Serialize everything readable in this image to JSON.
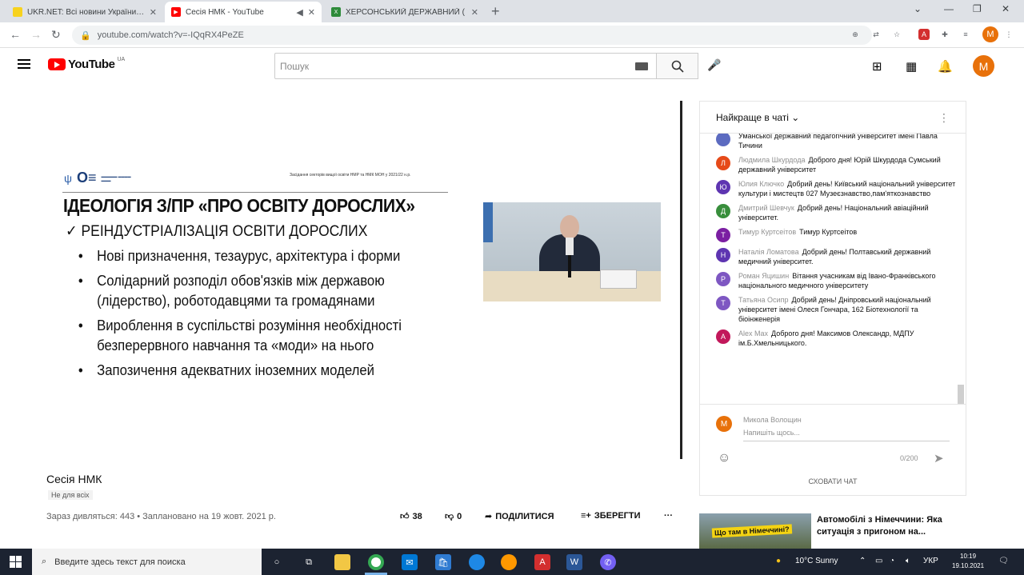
{
  "browser": {
    "tabs": [
      {
        "title": "UKR.NET: Всі новини України, о"
      },
      {
        "title": "Сесія НМК - YouTube"
      },
      {
        "title": "ХЕРСОНСЬКИЙ ДЕРЖАВНИЙ ("
      }
    ],
    "url": "youtube.com/watch?v=-IQqRX4PeZE"
  },
  "youtube": {
    "logo_text": "YouTube",
    "country": "UA",
    "search_placeholder": "Пошук",
    "user_initial": "М"
  },
  "slide": {
    "header_right": "Засідання секторів вищої освіти НМР та НМК МОН у 2021/22 н.р.",
    "title": "ІДЕОЛОГІЯ З/ПР «ПРО ОСВІТУ ДОРОСЛИХ»",
    "subtitle": "✓ РЕІНДУСТРІАЛІЗАЦІЯ ОСВІТИ ДОРОСЛИХ",
    "bullets": [
      "Нові призначення, тезаурус, архітектура і форми",
      "Солідарний розподіл обов'язків між державою (лідерство), роботодавцями та громадянами",
      "Вироблення в суспільстві розуміння необхідності безперервного навчання та «моди» на нього",
      "Запозичення адекватних іноземних моделей"
    ]
  },
  "video": {
    "title": "Сесія НМК",
    "audience": "Не для всіх",
    "meta": "Зараз дивляться: 443 • Заплановано на 19 жовт. 2021 р.",
    "likes": "38",
    "dislikes": "0",
    "share_label": "ПОДІЛИТИСЯ",
    "save_label": "ЗБЕРЕГТИ"
  },
  "chat": {
    "header": "Найкраще в чаті",
    "messages": [
      {
        "initial": "",
        "color": "#5c6bc0",
        "author": "",
        "text": "Уманської державний педагогічний університет імені Павла Тичини"
      },
      {
        "initial": "Л",
        "color": "#e64a19",
        "author": "Людмила Шкурдода",
        "text": "Доброго дня! Юрій Шкурдода Сумський державний університет"
      },
      {
        "initial": "Ю",
        "color": "#5e35b1",
        "author": "Юлия Ключко",
        "text": "Добрий день! Київський національний університет культури і мистецтв 027 Музеєзнавство,пам'яткознавство"
      },
      {
        "initial": "Д",
        "color": "#388e3c",
        "author": "Дмитрий Шевчук",
        "text": "Добрий день! Національний авіаційний університет."
      },
      {
        "initial": "Т",
        "color": "#7b1fa2",
        "author": "Тимур Куртсеітов",
        "text": "Тимур Куртсеітов"
      },
      {
        "initial": "Н",
        "color": "#5e35b1",
        "author": "Наталія Ломатова",
        "text": "Добрий день! Полтавський державний медичний університет."
      },
      {
        "initial": "Р",
        "color": "#7e57c2",
        "author": "Роман Яцишин",
        "text": "Вітання учасникам від Івано-Франківського національного медичного університету"
      },
      {
        "initial": "Т",
        "color": "#7e57c2",
        "author": "Татьяна Осипр",
        "text": "Добрий день! Дніпровський національний університет імені Олеся Гончара, 162 Біотехнології та біоінженерія"
      },
      {
        "initial": "А",
        "color": "#c2185b",
        "author": "Alex Max",
        "text": "Доброго дня! Максимов Олександр, МДПУ ім.Б.Хмельницького."
      }
    ],
    "current_user": "Микола Волощин",
    "input_placeholder": "Напишіть щось...",
    "counter": "0/200",
    "hide_label": "СХОВАТИ ЧАТ"
  },
  "recommended": {
    "thumb_text": "Що там в Німеччині?",
    "title": "Автомобілі з Німеччини: Яка ситуація з пригоном на..."
  },
  "taskbar": {
    "search_placeholder": "Введите здесь текст для поиска",
    "weather": "10°C  Sunny",
    "lang": "УКР",
    "time": "10:19",
    "date": "19.10.2021"
  }
}
